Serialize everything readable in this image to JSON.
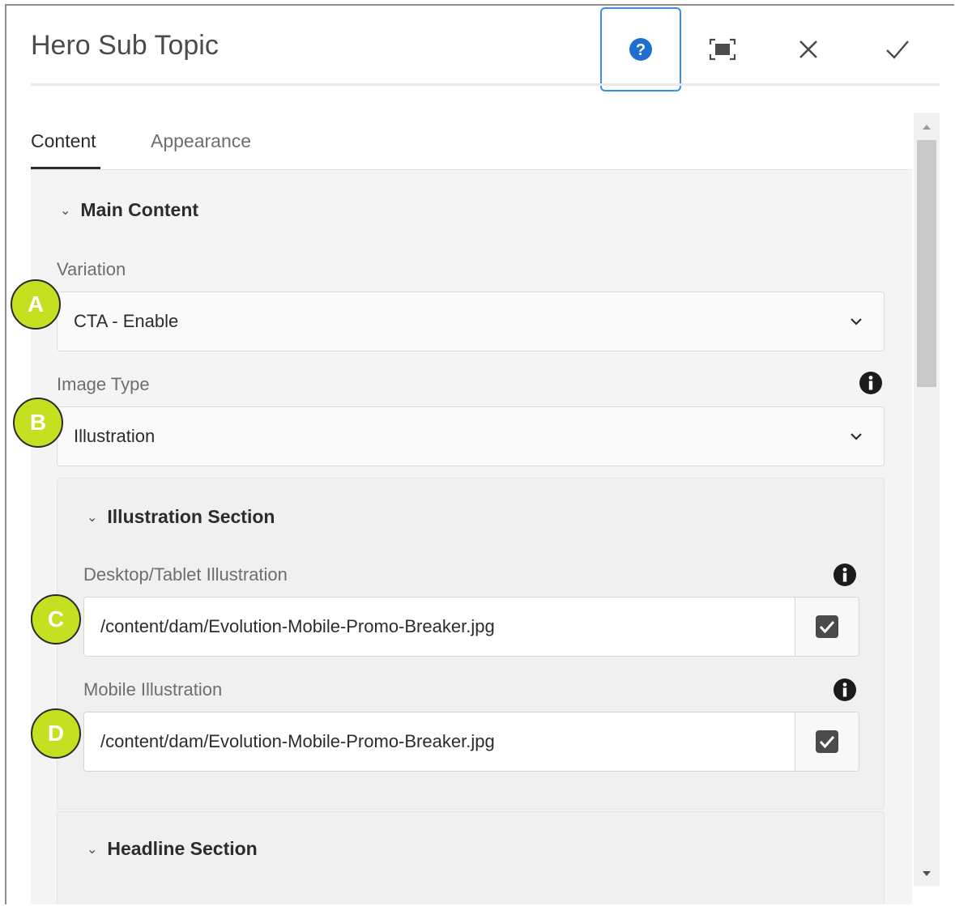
{
  "dialog": {
    "title": "Hero Sub Topic"
  },
  "header_icons": {
    "help": "help-icon",
    "fullscreen": "fullscreen-icon",
    "close": "close-icon",
    "done": "checkmark-icon"
  },
  "tabs": [
    {
      "label": "Content",
      "active": true
    },
    {
      "label": "Appearance",
      "active": false
    }
  ],
  "main_content": {
    "heading": "Main Content",
    "variation": {
      "label": "Variation",
      "value": "CTA - Enable"
    },
    "image_type": {
      "label": "Image Type",
      "value": "Illustration"
    }
  },
  "illustration_section": {
    "heading": "Illustration Section",
    "desktop": {
      "label": "Desktop/Tablet Illustration",
      "value": "/content/dam/Evolution-Mobile-Promo-Breaker.jpg"
    },
    "mobile": {
      "label": "Mobile Illustration",
      "value": "/content/dam/Evolution-Mobile-Promo-Breaker.jpg"
    }
  },
  "headline_section": {
    "heading": "Headline Section"
  },
  "markers": [
    "A",
    "B",
    "C",
    "D"
  ],
  "colors": {
    "accent_blue": "#378ef0",
    "marker_green": "#c5e020",
    "panel_bg": "#f4f4f4"
  }
}
